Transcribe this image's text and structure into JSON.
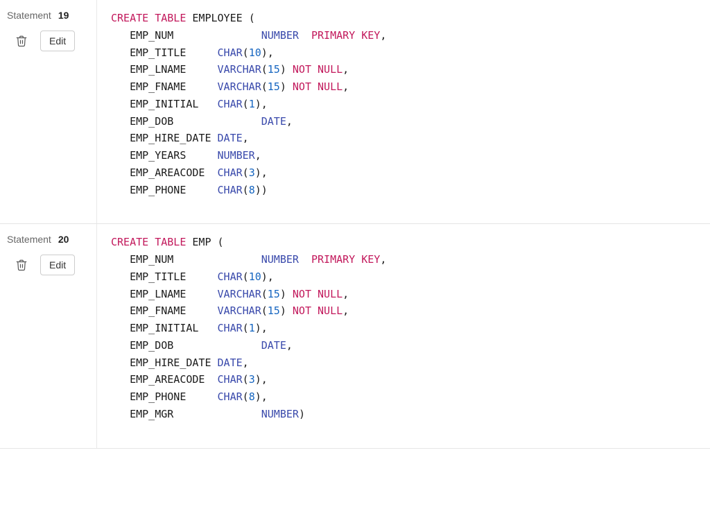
{
  "statements": [
    {
      "label": "Statement",
      "num": "19",
      "edit_label": "Edit",
      "code": [
        [
          [
            "kw-pink",
            "CREATE"
          ],
          [
            "plain",
            " "
          ],
          [
            "kw-pink",
            "TABLE"
          ],
          [
            "plain",
            " EMPLOYEE "
          ],
          [
            "punct",
            "("
          ]
        ],
        [
          [
            "plain",
            "   EMP_NUM              "
          ],
          [
            "kw-blue",
            "NUMBER"
          ],
          [
            "plain",
            "  "
          ],
          [
            "kw-pink",
            "PRIMARY"
          ],
          [
            "plain",
            " "
          ],
          [
            "kw-pink",
            "KEY"
          ],
          [
            "punct",
            ","
          ]
        ],
        [
          [
            "plain",
            "   EMP_TITLE     "
          ],
          [
            "kw-blue",
            "CHAR"
          ],
          [
            "punct",
            "("
          ],
          [
            "num-lit",
            "10"
          ],
          [
            "punct",
            ")"
          ],
          [
            "punct",
            ","
          ]
        ],
        [
          [
            "plain",
            "   EMP_LNAME     "
          ],
          [
            "kw-blue",
            "VARCHAR"
          ],
          [
            "punct",
            "("
          ],
          [
            "num-lit",
            "15"
          ],
          [
            "punct",
            ")"
          ],
          [
            "plain",
            " "
          ],
          [
            "kw-pink",
            "NOT"
          ],
          [
            "plain",
            " "
          ],
          [
            "kw-pink",
            "NULL"
          ],
          [
            "punct",
            ","
          ]
        ],
        [
          [
            "plain",
            "   EMP_FNAME     "
          ],
          [
            "kw-blue",
            "VARCHAR"
          ],
          [
            "punct",
            "("
          ],
          [
            "num-lit",
            "15"
          ],
          [
            "punct",
            ")"
          ],
          [
            "plain",
            " "
          ],
          [
            "kw-pink",
            "NOT"
          ],
          [
            "plain",
            " "
          ],
          [
            "kw-pink",
            "NULL"
          ],
          [
            "punct",
            ","
          ]
        ],
        [
          [
            "plain",
            "   EMP_INITIAL   "
          ],
          [
            "kw-blue",
            "CHAR"
          ],
          [
            "punct",
            "("
          ],
          [
            "num-lit",
            "1"
          ],
          [
            "punct",
            ")"
          ],
          [
            "punct",
            ","
          ]
        ],
        [
          [
            "plain",
            "   EMP_DOB              "
          ],
          [
            "kw-blue",
            "DATE"
          ],
          [
            "punct",
            ","
          ]
        ],
        [
          [
            "plain",
            "   EMP_HIRE_DATE "
          ],
          [
            "kw-blue",
            "DATE"
          ],
          [
            "punct",
            ","
          ]
        ],
        [
          [
            "plain",
            "   EMP_YEARS     "
          ],
          [
            "kw-blue",
            "NUMBER"
          ],
          [
            "punct",
            ","
          ]
        ],
        [
          [
            "plain",
            "   EMP_AREACODE  "
          ],
          [
            "kw-blue",
            "CHAR"
          ],
          [
            "punct",
            "("
          ],
          [
            "num-lit",
            "3"
          ],
          [
            "punct",
            ")"
          ],
          [
            "punct",
            ","
          ]
        ],
        [
          [
            "plain",
            "   EMP_PHONE     "
          ],
          [
            "kw-blue",
            "CHAR"
          ],
          [
            "punct",
            "("
          ],
          [
            "num-lit",
            "8"
          ],
          [
            "punct",
            ")"
          ],
          [
            "punct",
            ")"
          ]
        ]
      ]
    },
    {
      "label": "Statement",
      "num": "20",
      "edit_label": "Edit",
      "code": [
        [
          [
            "kw-pink",
            "CREATE"
          ],
          [
            "plain",
            " "
          ],
          [
            "kw-pink",
            "TABLE"
          ],
          [
            "plain",
            " EMP "
          ],
          [
            "punct",
            "("
          ]
        ],
        [
          [
            "plain",
            "   EMP_NUM              "
          ],
          [
            "kw-blue",
            "NUMBER"
          ],
          [
            "plain",
            "  "
          ],
          [
            "kw-pink",
            "PRIMARY"
          ],
          [
            "plain",
            " "
          ],
          [
            "kw-pink",
            "KEY"
          ],
          [
            "punct",
            ","
          ]
        ],
        [
          [
            "plain",
            "   EMP_TITLE     "
          ],
          [
            "kw-blue",
            "CHAR"
          ],
          [
            "punct",
            "("
          ],
          [
            "num-lit",
            "10"
          ],
          [
            "punct",
            ")"
          ],
          [
            "punct",
            ","
          ]
        ],
        [
          [
            "plain",
            "   EMP_LNAME     "
          ],
          [
            "kw-blue",
            "VARCHAR"
          ],
          [
            "punct",
            "("
          ],
          [
            "num-lit",
            "15"
          ],
          [
            "punct",
            ")"
          ],
          [
            "plain",
            " "
          ],
          [
            "kw-pink",
            "NOT"
          ],
          [
            "plain",
            " "
          ],
          [
            "kw-pink",
            "NULL"
          ],
          [
            "punct",
            ","
          ]
        ],
        [
          [
            "plain",
            "   EMP_FNAME     "
          ],
          [
            "kw-blue",
            "VARCHAR"
          ],
          [
            "punct",
            "("
          ],
          [
            "num-lit",
            "15"
          ],
          [
            "punct",
            ")"
          ],
          [
            "plain",
            " "
          ],
          [
            "kw-pink",
            "NOT"
          ],
          [
            "plain",
            " "
          ],
          [
            "kw-pink",
            "NULL"
          ],
          [
            "punct",
            ","
          ]
        ],
        [
          [
            "plain",
            "   EMP_INITIAL   "
          ],
          [
            "kw-blue",
            "CHAR"
          ],
          [
            "punct",
            "("
          ],
          [
            "num-lit",
            "1"
          ],
          [
            "punct",
            ")"
          ],
          [
            "punct",
            ","
          ]
        ],
        [
          [
            "plain",
            "   EMP_DOB              "
          ],
          [
            "kw-blue",
            "DATE"
          ],
          [
            "punct",
            ","
          ]
        ],
        [
          [
            "plain",
            "   EMP_HIRE_DATE "
          ],
          [
            "kw-blue",
            "DATE"
          ],
          [
            "punct",
            ","
          ]
        ],
        [
          [
            "plain",
            "   EMP_AREACODE  "
          ],
          [
            "kw-blue",
            "CHAR"
          ],
          [
            "punct",
            "("
          ],
          [
            "num-lit",
            "3"
          ],
          [
            "punct",
            ")"
          ],
          [
            "punct",
            ","
          ]
        ],
        [
          [
            "plain",
            "   EMP_PHONE     "
          ],
          [
            "kw-blue",
            "CHAR"
          ],
          [
            "punct",
            "("
          ],
          [
            "num-lit",
            "8"
          ],
          [
            "punct",
            ")"
          ],
          [
            "punct",
            ","
          ]
        ],
        [
          [
            "plain",
            "   EMP_MGR              "
          ],
          [
            "kw-blue",
            "NUMBER"
          ],
          [
            "punct",
            ")"
          ]
        ]
      ]
    }
  ]
}
